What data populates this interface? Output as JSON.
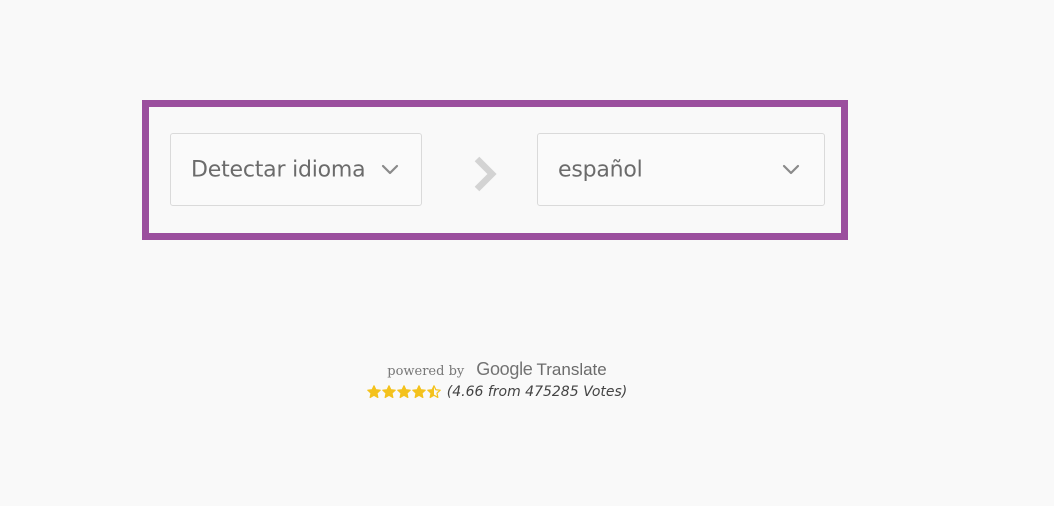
{
  "translator": {
    "source_language": "Detectar idioma",
    "target_language": "español"
  },
  "attribution": {
    "powered_by": "powered by",
    "brand_google": "Google",
    "brand_translate": "Translate"
  },
  "rating": {
    "score": 4.66,
    "max_score": 5,
    "text": "(4.66 from 475285 Votes)"
  },
  "icons": {
    "source_dropdown": "chevron-down-icon",
    "target_dropdown": "chevron-down-icon",
    "direction": "chevron-right-icon",
    "rating": "star-icon"
  },
  "colors": {
    "panel_border": "#9b4f9e",
    "star_fill": "#f4c21d",
    "page_background": "#f9f9f9"
  }
}
